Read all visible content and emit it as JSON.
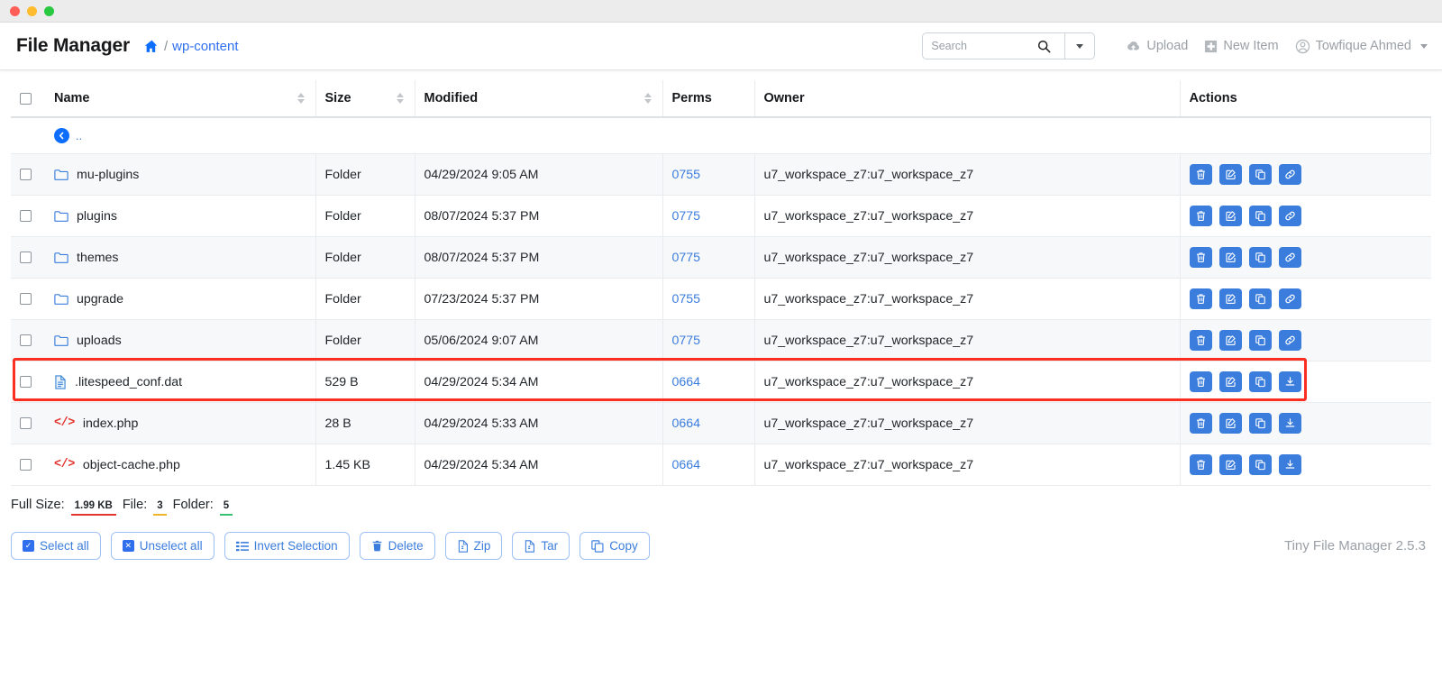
{
  "window": {
    "traffic_lights": [
      "close",
      "minimize",
      "maximize"
    ]
  },
  "header": {
    "brand": "File Manager",
    "breadcrumb": {
      "home_icon": "home-icon",
      "separator": "/",
      "current": "wp-content"
    },
    "search": {
      "placeholder": "Search",
      "value": "",
      "icon": "search-icon",
      "dropdown_icon": "chevron-down-icon"
    },
    "actions": [
      {
        "label": "Upload",
        "icon": "upload-cloud-icon"
      },
      {
        "label": "New Item",
        "icon": "plus-square-icon"
      },
      {
        "label": "Towfique Ahmed",
        "icon": "user-circle-icon",
        "has_caret": true
      }
    ]
  },
  "table": {
    "columns": [
      {
        "key": "checkbox",
        "label": "",
        "sortable": false
      },
      {
        "key": "name",
        "label": "Name",
        "sortable": true
      },
      {
        "key": "size",
        "label": "Size",
        "sortable": true
      },
      {
        "key": "modified",
        "label": "Modified",
        "sortable": true
      },
      {
        "key": "perms",
        "label": "Perms",
        "sortable": false
      },
      {
        "key": "owner",
        "label": "Owner",
        "sortable": false
      },
      {
        "key": "actions",
        "label": "Actions",
        "sortable": false
      }
    ],
    "parent_row": {
      "label": "..",
      "icon": "back-arrow-circle-icon"
    },
    "rows": [
      {
        "name": "mu-plugins",
        "icon": "folder-icon",
        "type": "folder",
        "size": "Folder",
        "modified": "04/29/2024 9:05 AM",
        "perms": "0755",
        "owner": "u7_workspace_z7:u7_workspace_z7",
        "actions": [
          "delete-icon",
          "edit-icon",
          "copy-icon",
          "link-icon"
        ],
        "highlighted": false
      },
      {
        "name": "plugins",
        "icon": "folder-icon",
        "type": "folder",
        "size": "Folder",
        "modified": "08/07/2024 5:37 PM",
        "perms": "0775",
        "owner": "u7_workspace_z7:u7_workspace_z7",
        "actions": [
          "delete-icon",
          "edit-icon",
          "copy-icon",
          "link-icon"
        ],
        "highlighted": false
      },
      {
        "name": "themes",
        "icon": "folder-icon",
        "type": "folder",
        "size": "Folder",
        "modified": "08/07/2024 5:37 PM",
        "perms": "0775",
        "owner": "u7_workspace_z7:u7_workspace_z7",
        "actions": [
          "delete-icon",
          "edit-icon",
          "copy-icon",
          "link-icon"
        ],
        "highlighted": false
      },
      {
        "name": "upgrade",
        "icon": "folder-icon",
        "type": "folder",
        "size": "Folder",
        "modified": "07/23/2024 5:37 PM",
        "perms": "0755",
        "owner": "u7_workspace_z7:u7_workspace_z7",
        "actions": [
          "delete-icon",
          "edit-icon",
          "copy-icon",
          "link-icon"
        ],
        "highlighted": false
      },
      {
        "name": "uploads",
        "icon": "folder-icon",
        "type": "folder",
        "size": "Folder",
        "modified": "05/06/2024 9:07 AM",
        "perms": "0775",
        "owner": "u7_workspace_z7:u7_workspace_z7",
        "actions": [
          "delete-icon",
          "edit-icon",
          "copy-icon",
          "link-icon"
        ],
        "highlighted": false
      },
      {
        "name": ".litespeed_conf.dat",
        "icon": "document-icon",
        "type": "file",
        "size": "529 B",
        "modified": "04/29/2024 5:34 AM",
        "perms": "0664",
        "owner": "u7_workspace_z7:u7_workspace_z7",
        "actions": [
          "delete-icon",
          "edit-icon",
          "copy-icon",
          "download-icon"
        ],
        "highlighted": true
      },
      {
        "name": "index.php",
        "icon": "code-icon",
        "type": "file",
        "size": "28 B",
        "modified": "04/29/2024 5:33 AM",
        "perms": "0664",
        "owner": "u7_workspace_z7:u7_workspace_z7",
        "actions": [
          "delete-icon",
          "edit-icon",
          "copy-icon",
          "download-icon"
        ],
        "highlighted": false
      },
      {
        "name": "object-cache.php",
        "icon": "code-icon",
        "type": "file",
        "size": "1.45 KB",
        "modified": "04/29/2024 5:34 AM",
        "perms": "0664",
        "owner": "u7_workspace_z7:u7_workspace_z7",
        "actions": [
          "delete-icon",
          "edit-icon",
          "copy-icon",
          "download-icon"
        ],
        "highlighted": false
      }
    ]
  },
  "summary": {
    "full_size_label": "Full Size:",
    "full_size_value": "1.99 KB",
    "file_label": "File:",
    "file_value": "3",
    "folder_label": "Folder:",
    "folder_value": "5"
  },
  "toolbar": {
    "buttons": [
      {
        "label": "Select all",
        "icon": "check-square-icon"
      },
      {
        "label": "Unselect all",
        "icon": "x-square-icon"
      },
      {
        "label": "Invert Selection",
        "icon": "list-icon"
      },
      {
        "label": "Delete",
        "icon": "trash-icon"
      },
      {
        "label": "Zip",
        "icon": "file-archive-icon"
      },
      {
        "label": "Tar",
        "icon": "file-archive-icon"
      },
      {
        "label": "Copy",
        "icon": "copy-icon"
      }
    ]
  },
  "footer": {
    "version": "Tiny File Manager 2.5.3"
  },
  "colors": {
    "accent": "#3b7ddd",
    "link": "#2f6fed",
    "annotation": "#fa2f22",
    "code_icon": "#e3342f",
    "underline_red": "#e3342f",
    "underline_yellow": "#f0b429",
    "underline_green": "#38c172"
  }
}
